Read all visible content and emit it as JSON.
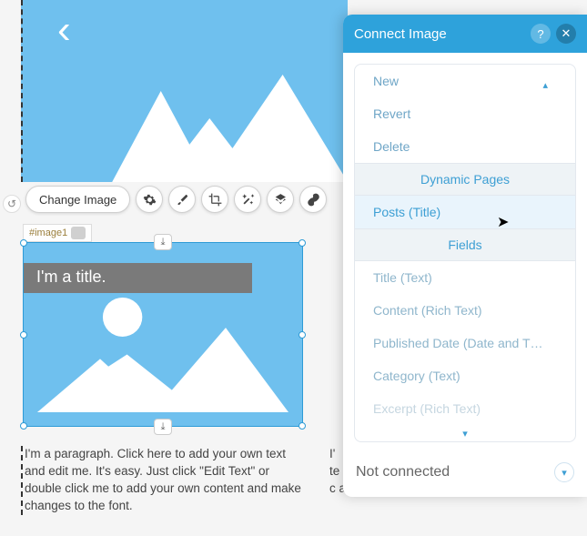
{
  "hero": {
    "chevron": "‹"
  },
  "toolbar": {
    "change_image": "Change Image",
    "icons": [
      "gear",
      "brush",
      "crop",
      "magic",
      "layers",
      "link"
    ]
  },
  "element_tag": "#image1",
  "image_title": "I'm a title.",
  "paragraph1": "I'm a paragraph. Click here to add your own text and edit me. It's easy. Just click \"Edit Text\" or double click me to add your own content and make changes to the font.",
  "paragraph2_visible": "I' te c a",
  "panel": {
    "title": "Connect Image",
    "dropdown": {
      "items_top": [
        "New",
        "Revert",
        "Delete"
      ],
      "section1": "Dynamic Pages",
      "highlighted": "Posts (Title)",
      "section2": "Fields",
      "fields": [
        "Title (Text)",
        "Content (Rich Text)",
        "Published Date (Date and T…",
        "Category (Text)",
        "Excerpt (Rich Text)"
      ]
    },
    "footer": "Not connected"
  },
  "colors": {
    "brand": "#2ea2db",
    "skyblue": "#6fc0ee"
  }
}
